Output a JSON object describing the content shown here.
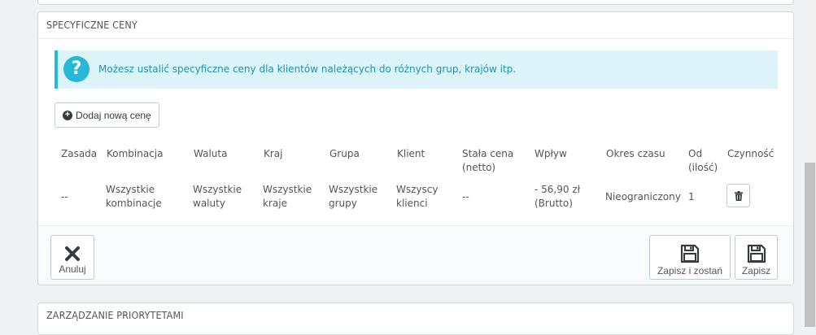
{
  "specific_prices": {
    "heading": "SPECYFICZNE CENY",
    "info_text": "Możesz ustalić specyficzne ceny dla klientów należących do różnych grup, krajów itp.",
    "add_button_label": "Dodaj nową cenę",
    "columns": {
      "rule": "Zasada",
      "combination": "Kombinacja",
      "currency": "Waluta",
      "country": "Kraj",
      "group": "Grupa",
      "customer": "Klient",
      "fixed_price_l1": "Stała cena",
      "fixed_price_l2": "(netto)",
      "impact": "Wpływ",
      "period": "Okres czasu",
      "from_l1": "Od",
      "from_l2": "(ilość)",
      "action": "Czynność"
    },
    "rows": [
      {
        "rule": "--",
        "combination_l1": "Wszystkie",
        "combination_l2": "kombinacje",
        "currency_l1": "Wszystkie",
        "currency_l2": "waluty",
        "country_l1": "Wszystkie",
        "country_l2": "kraje",
        "group_l1": "Wszystkie",
        "group_l2": "grupy",
        "customer_l1": "Wszyscy",
        "customer_l2": "klienci",
        "fixed_price": "--",
        "impact_l1": "- 56,90 zł",
        "impact_l2": "(Brutto)",
        "period": "Nieograniczony",
        "from_qty": "1"
      }
    ],
    "footer": {
      "cancel_label": "Anuluj",
      "save_stay_label": "Zapisz i zostań",
      "save_label": "Zapisz"
    }
  },
  "priorities": {
    "heading": "ZARZĄDZANIE PRIORYTETAMI"
  },
  "colors": {
    "info_bg": "#dcf4f9",
    "info_accent": "#25b9d7",
    "info_text": "#1e94ab"
  }
}
